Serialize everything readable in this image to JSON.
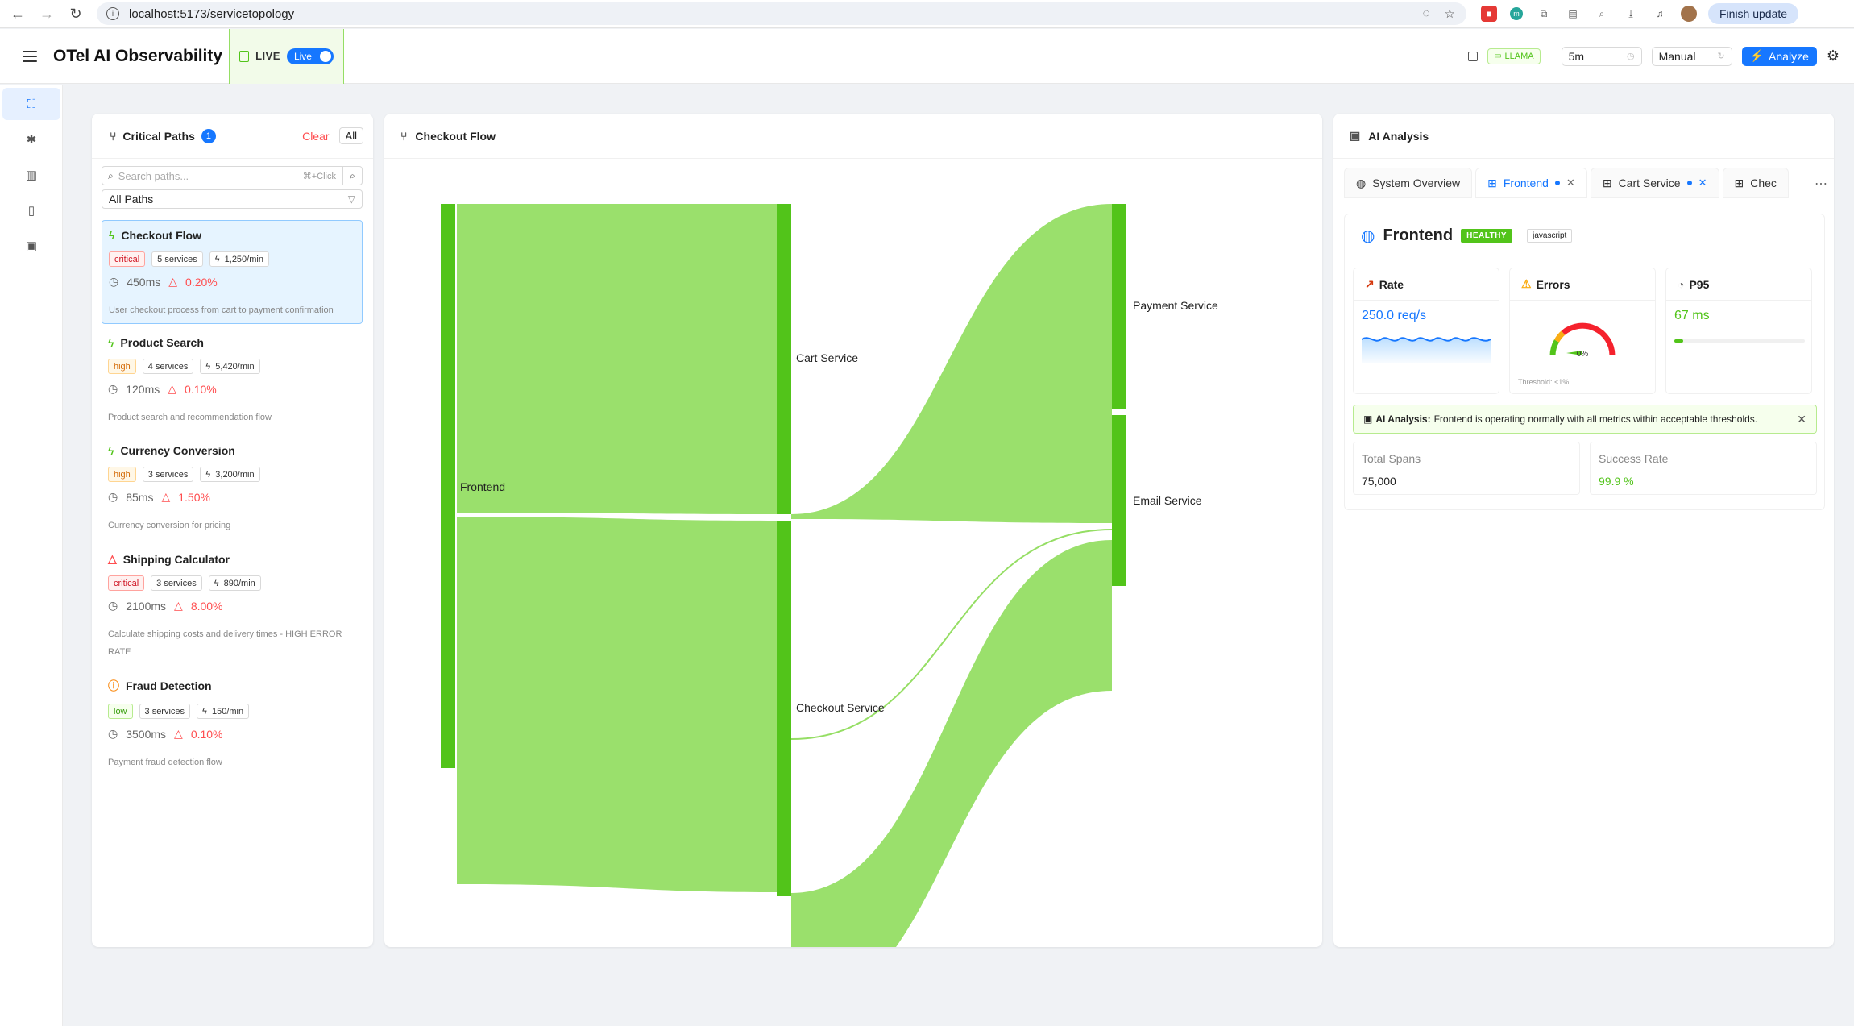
{
  "browser": {
    "url": "localhost:5173/servicetopology",
    "finish_update": "Finish update"
  },
  "header": {
    "app_title": "OTel AI Observability",
    "live_label": "LIVE",
    "live_toggle": "Live",
    "model_tag": "LLAMA",
    "time_range": "5m",
    "refresh_mode": "Manual",
    "analyze_label": "Analyze"
  },
  "critical_paths": {
    "title": "Critical Paths",
    "count": "1",
    "clear_label": "Clear",
    "all_label": "All",
    "search_placeholder": "Search paths...",
    "search_hint": "⌘+Click",
    "filter_value": "All Paths",
    "items": [
      {
        "name": "Checkout Flow",
        "priority": "critical",
        "services": "5 services",
        "rate": "1,250/min",
        "latency": "450ms",
        "error": "0.20%",
        "desc": "User checkout process from cart to payment confirmation"
      },
      {
        "name": "Product Search",
        "priority": "high",
        "services": "4 services",
        "rate": "5,420/min",
        "latency": "120ms",
        "error": "0.10%",
        "desc": "Product search and recommendation flow"
      },
      {
        "name": "Currency Conversion",
        "priority": "high",
        "services": "3 services",
        "rate": "3,200/min",
        "latency": "85ms",
        "error": "1.50%",
        "desc": "Currency conversion for pricing"
      },
      {
        "name": "Shipping Calculator",
        "priority": "critical",
        "services": "3 services",
        "rate": "890/min",
        "latency": "2100ms",
        "error": "8.00%",
        "desc": "Calculate shipping costs and delivery times - HIGH ERROR RATE"
      },
      {
        "name": "Fraud Detection",
        "priority": "low",
        "services": "3 services",
        "rate": "150/min",
        "latency": "3500ms",
        "error": "0.10%",
        "desc": "Payment fraud detection flow"
      }
    ]
  },
  "flow": {
    "title": "Checkout Flow",
    "nodes": {
      "frontend": "Frontend",
      "cart": "Cart Service",
      "checkout": "Checkout Service",
      "payment": "Payment Service",
      "email": "Email Service"
    },
    "colors": {
      "node": "#52c41a",
      "link": "#95de64"
    }
  },
  "ai": {
    "title": "AI Analysis",
    "tabs": [
      {
        "label": "System Overview"
      },
      {
        "label": "Frontend"
      },
      {
        "label": "Cart Service"
      },
      {
        "label": "Chec"
      }
    ],
    "service": {
      "name": "Frontend",
      "status": "HEALTHY",
      "language": "javascript"
    },
    "metrics": {
      "rate_title": "Rate",
      "rate_value": "250.0 req/s",
      "errors_title": "Errors",
      "errors_value": "0%",
      "errors_threshold": "Threshold: <1%",
      "p95_title": "P95",
      "p95_value": "67 ms"
    },
    "analysis_label": "AI Analysis:",
    "analysis_text": "Frontend is operating normally with all metrics within acceptable thresholds.",
    "stats": {
      "total_spans_label": "Total Spans",
      "total_spans": "75,000",
      "success_rate_label": "Success Rate",
      "success_rate": "99.9 %"
    }
  }
}
